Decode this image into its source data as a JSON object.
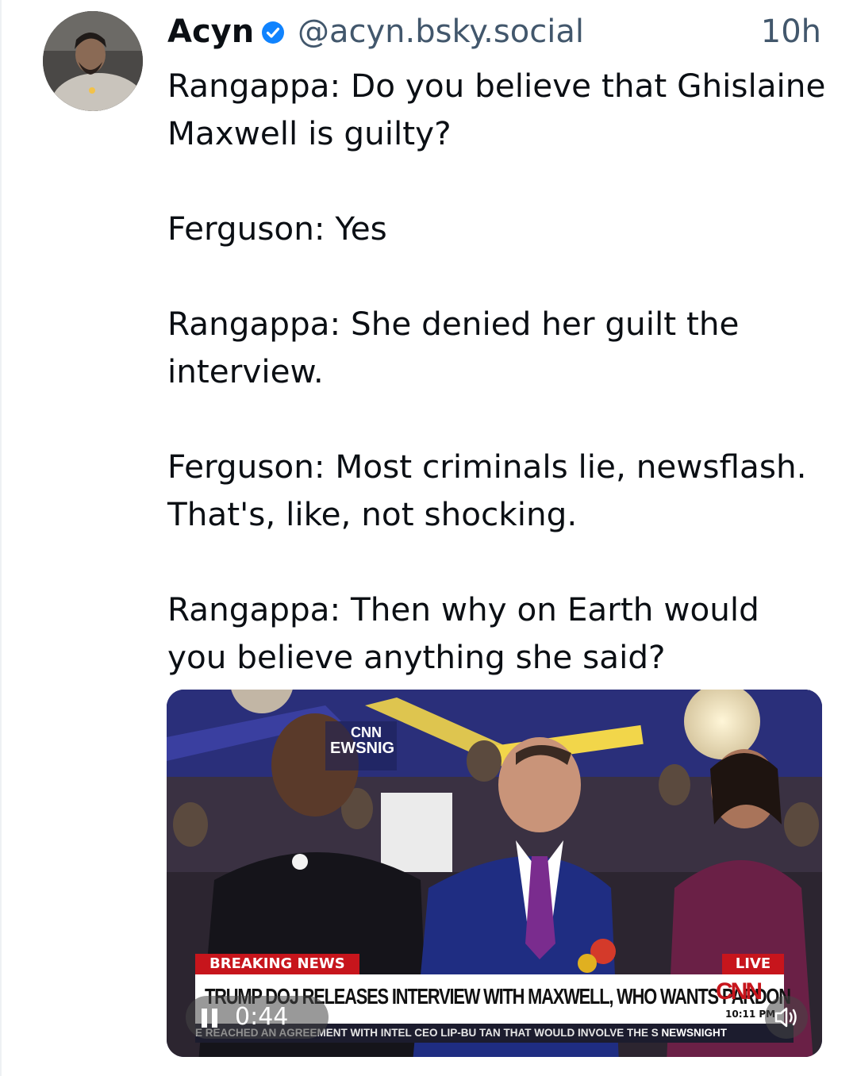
{
  "post": {
    "author_name": "Acyn",
    "author_handle": "@acyn.bsky.social",
    "timestamp": "10h",
    "verified": true,
    "paragraphs": [
      "Rangappa: Do you believe that Ghislaine Maxwell is guilty?",
      "Ferguson: Yes",
      "Rangappa: She denied her guilt the interview.",
      "Ferguson: Most criminals lie, newsflash. That's, like, not shocking.",
      "Rangappa: Then why on Earth would you believe anything she said?"
    ]
  },
  "video": {
    "breaking_label": "BREAKING NEWS",
    "live_label": "LIVE",
    "headline": "TRUMP DOJ RELEASES INTERVIEW WITH MAXWELL, WHO WANTS PARDON",
    "network_logo": "CNN",
    "clock": "10:11 PM",
    "ticker": "E REACHED AN AGREEMENT WITH INTEL CEO LIP-BU TAN THAT WOULD INVOLVE THE S",
    "ticker_network": "NEWSNIGHT",
    "duration": "0:44",
    "state": "playing",
    "muted": false
  },
  "colors": {
    "text": "#0b0f14",
    "secondary": "#42576c",
    "verified": "#1083fe",
    "cnn_red": "#c7151c"
  },
  "icons": [
    "verified-badge-icon",
    "pause-icon",
    "volume-icon"
  ]
}
